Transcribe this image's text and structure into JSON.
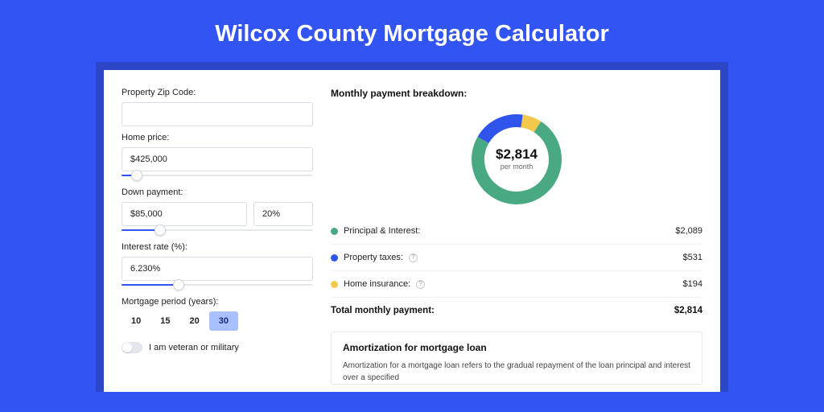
{
  "title": "Wilcox County Mortgage Calculator",
  "form": {
    "zip_label": "Property Zip Code:",
    "zip_value": "",
    "home_price_label": "Home price:",
    "home_price_value": "$425,000",
    "home_price_slider_pct": 8,
    "down_payment_label": "Down payment:",
    "down_payment_value": "$85,000",
    "down_payment_pct": "20%",
    "down_payment_slider_pct": 20,
    "rate_label": "Interest rate (%):",
    "rate_value": "6.230%",
    "rate_slider_pct": 30,
    "period_label": "Mortgage period (years):",
    "periods": [
      "10",
      "15",
      "20",
      "30"
    ],
    "period_active_index": 3,
    "veteran_label": "I am veteran or military"
  },
  "breakdown": {
    "heading": "Monthly payment breakdown:",
    "center_value": "$2,814",
    "center_sub": "per month",
    "items": [
      {
        "label": "Principal & Interest:",
        "value": "$2,089",
        "color": "#49a983",
        "has_info": false
      },
      {
        "label": "Property taxes:",
        "value": "$531",
        "color": "#2f54eb",
        "has_info": true
      },
      {
        "label": "Home insurance:",
        "value": "$194",
        "color": "#f2c94c",
        "has_info": true
      }
    ],
    "total_label": "Total monthly payment:",
    "total_value": "$2,814"
  },
  "chart_data": {
    "type": "pie",
    "title": "Monthly payment breakdown:",
    "categories": [
      "Principal & Interest",
      "Property taxes",
      "Home insurance"
    ],
    "values": [
      2089,
      531,
      194
    ],
    "colors": [
      "#49a983",
      "#2f54eb",
      "#f2c94c"
    ],
    "total": 2814,
    "donut": true
  },
  "amort": {
    "title": "Amortization for mortgage loan",
    "text": "Amortization for a mortgage loan refers to the gradual repayment of the loan principal and interest over a specified"
  }
}
